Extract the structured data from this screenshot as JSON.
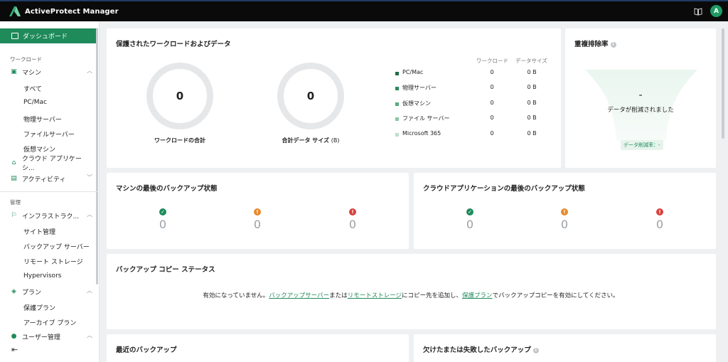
{
  "app": {
    "title": "ActiveProtect Manager",
    "avatar_letter": "A"
  },
  "sidebar": {
    "active": "ダッシュボード",
    "section_workload": "ワークロード",
    "machine": "マシン",
    "machine_children": [
      "すべて",
      "PC/Mac",
      "物理サーバー",
      "ファイルサーバー",
      "仮想マシン"
    ],
    "cloud_apps": "クラウド アプリケーシ...",
    "activity": "アクティビティ",
    "section_admin": "管理",
    "infra": "インフラストラク...",
    "infra_children": [
      "サイト管理",
      "バックアップ サーバー",
      "リモート ストレージ",
      "Hypervisors"
    ],
    "plan": "プラン",
    "plan_children": [
      "保護プラン",
      "アーカイブ プラン"
    ],
    "user_mgmt": "ユーザー管理"
  },
  "protected": {
    "title": "保護されたワークロードおよびデータ",
    "total_workloads_value": "0",
    "total_workloads_label": "ワークロードの合計",
    "total_data_value": "0",
    "total_data_label": "合計データ サイズ",
    "total_data_unit": "(B)",
    "col_workload": "ワークロード",
    "col_datasize": "データサイズ",
    "rows": [
      {
        "name": "PC/Mac",
        "workloads": "0",
        "size": "0 B",
        "color": "#1f6e4a"
      },
      {
        "name": "物理サーバー",
        "workloads": "0",
        "size": "0 B",
        "color": "#2e8a5e"
      },
      {
        "name": "仮想マシン",
        "workloads": "0",
        "size": "0 B",
        "color": "#5aa982"
      },
      {
        "name": "ファイル サーバー",
        "workloads": "0",
        "size": "0 B",
        "color": "#8cc6a8"
      },
      {
        "name": "Microsoft 365",
        "workloads": "0",
        "size": "0 B",
        "color": "#bfe0cd"
      }
    ]
  },
  "dedupe": {
    "title": "重複排除率",
    "value": "-",
    "message": "データが削減されました",
    "badge": "データ削減率：-"
  },
  "machine_backup": {
    "title": "マシンの最後のバックアップ状態",
    "success": "0",
    "warning": "0",
    "error": "0"
  },
  "cloud_backup": {
    "title": "クラウドアプリケーションの最後のバックアップ状態",
    "success": "0",
    "warning": "0",
    "error": "0"
  },
  "copy_status": {
    "title": "バックアップ コピー ステータス",
    "msg_prefix": "有効になっていません。",
    "link_backup_server": "バックアップサーバー",
    "msg_or": "または",
    "link_remote_storage": "リモートストレージ",
    "msg_mid": "にコピー先を追加し、",
    "link_protection_plan": "保護プラン",
    "msg_suffix": "でバックアップコピーを有効にしてください。"
  },
  "recent_backup": {
    "title": "最近のバックアップ"
  },
  "missed_backup": {
    "title": "欠けたまたは失敗したバックアップ"
  },
  "colors": {
    "accent": "#1f8a5a",
    "success": "#1f8a5a",
    "warning": "#e8892b",
    "error": "#d9413d"
  }
}
